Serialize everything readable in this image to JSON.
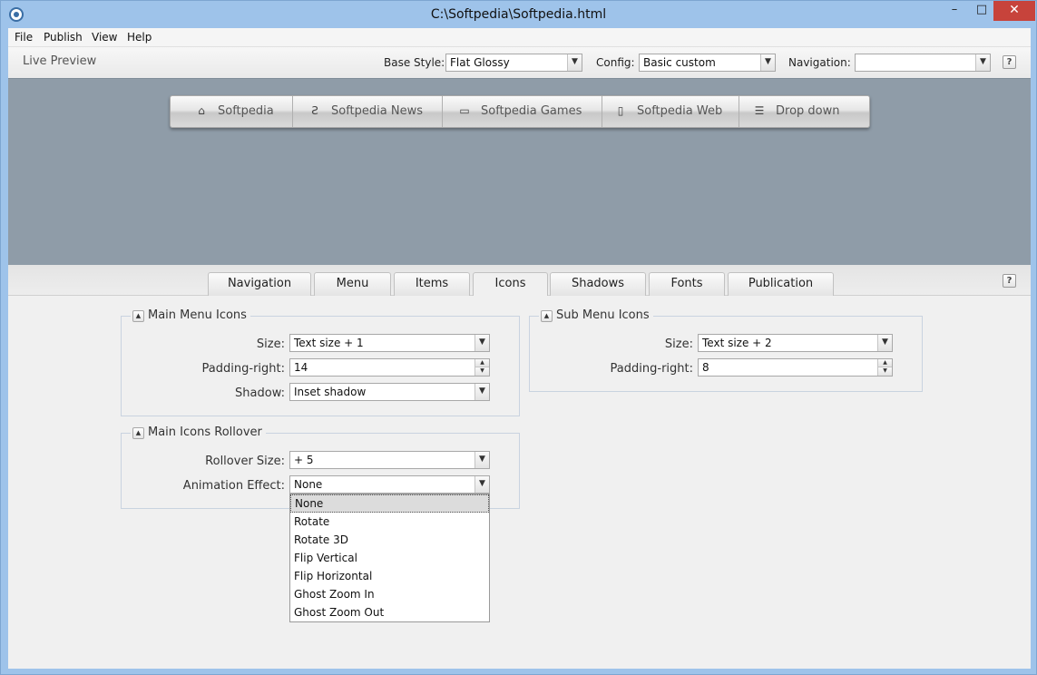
{
  "window": {
    "title": "C:\\Softpedia\\Softpedia.html",
    "min": "–",
    "max": "□",
    "close": "✕"
  },
  "menubar": {
    "items": [
      "File",
      "Publish",
      "View",
      "Help"
    ]
  },
  "toolbar": {
    "live_preview": "Live Preview",
    "base_style_label": "Base Style:",
    "base_style_value": "Flat Glossy",
    "config_label": "Config:",
    "config_value": "Basic custom",
    "navigation_label": "Navigation:",
    "navigation_value": "",
    "help": "?"
  },
  "preview": {
    "nav_items": [
      {
        "label": "Softpedia",
        "icon": "home-icon",
        "glyph": "⌂"
      },
      {
        "label": "Softpedia News",
        "icon": "css3-icon",
        "glyph": "Ƨ"
      },
      {
        "label": "Softpedia Games",
        "icon": "desktop-icon",
        "glyph": "▭"
      },
      {
        "label": "Softpedia Web",
        "icon": "mobile-icon",
        "glyph": "▯"
      },
      {
        "label": "Drop down",
        "icon": "list-icon",
        "glyph": "☰"
      }
    ]
  },
  "tabs": {
    "items": [
      "Navigation",
      "Menu",
      "Items",
      "Icons",
      "Shadows",
      "Fonts",
      "Publication"
    ],
    "active": "Icons",
    "help": "?"
  },
  "main_menu_icons": {
    "title": "Main Menu Icons",
    "size_label": "Size:",
    "size_value": "Text size + 1",
    "padding_label": "Padding-right:",
    "padding_value": "14",
    "shadow_label": "Shadow:",
    "shadow_value": "Inset shadow"
  },
  "sub_menu_icons": {
    "title": "Sub Menu Icons",
    "size_label": "Size:",
    "size_value": "Text size + 2",
    "padding_label": "Padding-right:",
    "padding_value": "8"
  },
  "main_icons_rollover": {
    "title": "Main Icons Rollover",
    "rollover_label": "Rollover Size:",
    "rollover_value": "+ 5",
    "animation_label": "Animation Effect:",
    "animation_value": "None",
    "animation_options": [
      "None",
      "Rotate",
      "Rotate 3D",
      "Flip Vertical",
      "Flip Horizontal",
      "Ghost Zoom In",
      "Ghost Zoom Out"
    ]
  },
  "colors": {
    "titlebar": "#9ec3ea",
    "close": "#c7433b",
    "preview_bg": "#8f9ca8"
  }
}
